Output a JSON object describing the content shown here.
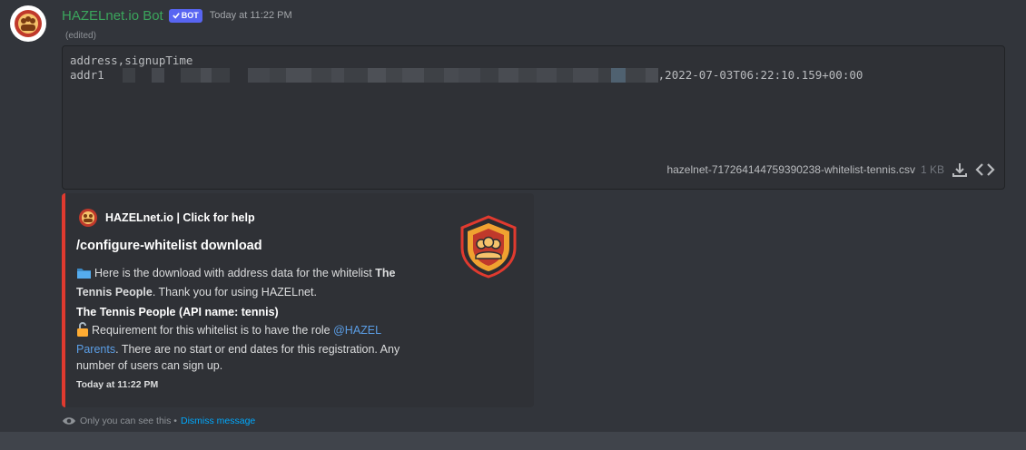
{
  "message": {
    "username": "HAZELnet.io Bot",
    "bot_tag": "BOT",
    "timestamp": "Today at 11:22 PM",
    "edited": "(edited)"
  },
  "attachment": {
    "code_line1": "address,signupTime",
    "code_line2_prefix": "addr1",
    "code_line2_suffix": ",2022-07-03T06:22:10.159+00:00",
    "filename": "hazelnet-717264144759390238-whitelist-tennis.csv",
    "filesize": "1 KB"
  },
  "embed": {
    "author": "HAZELnet.io | Click for help",
    "title": "/configure-whitelist download",
    "desc_part1": "Here is the download with address data for the whitelist",
    "desc_bold": "The Tennis People",
    "desc_part2": ". Thank you for using HAZELnet.",
    "field_name": "The Tennis People (API name: tennis)",
    "field_part1": "Requirement for this whitelist is to have the role",
    "field_mention": "@HAZEL Parents",
    "field_part2": ". There are no start or end dates for this registration. Any number of users can sign up.",
    "footer": "Today at 11:22 PM",
    "accent_color": "#e03a2f"
  },
  "ephemeral": {
    "text": "Only you can see this •",
    "dismiss": "Dismiss message"
  },
  "icons": {
    "desc_emoji": "folder-icon",
    "field_emoji": "unlock-icon"
  }
}
